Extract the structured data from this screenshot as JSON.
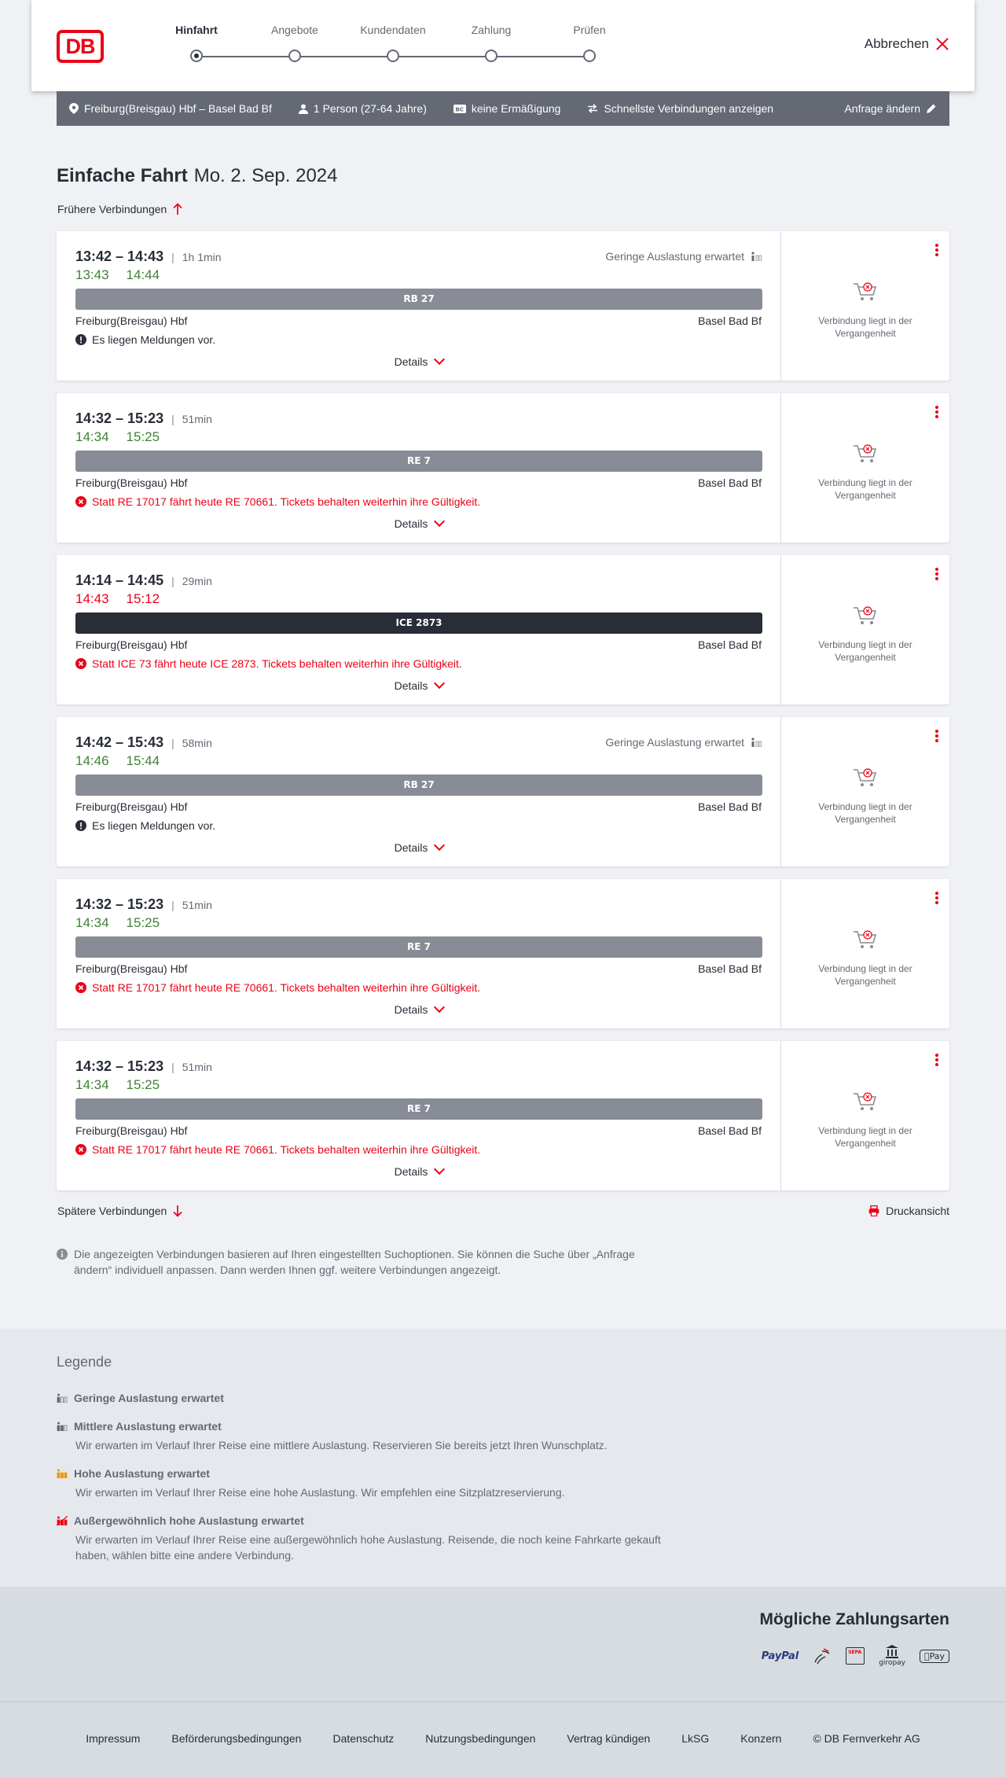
{
  "header": {
    "logo_text": "DB",
    "steps": [
      "Hinfahrt",
      "Angebote",
      "Kundendaten",
      "Zahlung",
      "Prüfen"
    ],
    "active_step": 0,
    "cancel_label": "Abbrechen"
  },
  "query": {
    "route": "Freiburg(Breisgau) Hbf – Basel Bad Bf",
    "persons": "1 Person (27-64 Jahre)",
    "discount": "keine Ermäßigung",
    "fastest": "Schnellste Verbindungen anzeigen",
    "edit_label": "Anfrage ändern"
  },
  "page": {
    "title": "Einfache Fahrt",
    "date": "Mo. 2. Sep. 2024",
    "earlier_label": "Frühere Verbindungen",
    "later_label": "Spätere Verbindungen",
    "print_label": "Druckansicht",
    "details_label": "Details",
    "past_label": "Verbindung liegt in der Vergangenheit",
    "info_text": "Die angezeigten Verbindungen basieren auf Ihren eingestellten Suchoptionen. Sie können die Suche über „Anfrage ändern“ individuell anpassen. Dann werden Ihnen ggf. weitere Verbindungen angezeigt."
  },
  "connections": [
    {
      "times": "13:42 – 14:43",
      "duration": "1h 1min",
      "rt_dep": "13:43",
      "rt_arr": "14:44",
      "rt_status": "ok",
      "load": "Geringe Auslastung erwartet",
      "train": "RB 27",
      "train_type": "regional",
      "from": "Freiburg(Breisgau) Hbf",
      "to": "Basel Bad Bf",
      "message": "Es liegen Meldungen vor.",
      "message_type": "info"
    },
    {
      "times": "14:32 – 15:23",
      "duration": "51min",
      "rt_dep": "14:34",
      "rt_arr": "15:25",
      "rt_status": "ok",
      "load": "",
      "train": "RE 7",
      "train_type": "regional",
      "from": "Freiburg(Breisgau) Hbf",
      "to": "Basel Bad Bf",
      "message": "Statt RE 17017 fährt heute RE 70661. Tickets behalten weiterhin ihre Gültigkeit.",
      "message_type": "error"
    },
    {
      "times": "14:14 – 14:45",
      "duration": "29min",
      "rt_dep": "14:43",
      "rt_arr": "15:12",
      "rt_status": "late",
      "load": "",
      "train": "ICE 2873",
      "train_type": "ice",
      "from": "Freiburg(Breisgau) Hbf",
      "to": "Basel Bad Bf",
      "message": "Statt ICE 73 fährt heute ICE 2873. Tickets behalten weiterhin ihre Gültigkeit.",
      "message_type": "error"
    },
    {
      "times": "14:42 – 15:43",
      "duration": "58min",
      "rt_dep": "14:46",
      "rt_arr": "15:44",
      "rt_status": "ok",
      "load": "Geringe Auslastung erwartet",
      "train": "RB 27",
      "train_type": "regional",
      "from": "Freiburg(Breisgau) Hbf",
      "to": "Basel Bad Bf",
      "message": "Es liegen Meldungen vor.",
      "message_type": "info"
    },
    {
      "times": "14:32 – 15:23",
      "duration": "51min",
      "rt_dep": "14:34",
      "rt_arr": "15:25",
      "rt_status": "ok",
      "load": "",
      "train": "RE 7",
      "train_type": "regional",
      "from": "Freiburg(Breisgau) Hbf",
      "to": "Basel Bad Bf",
      "message": "Statt RE 17017 fährt heute RE 70661. Tickets behalten weiterhin ihre Gültigkeit.",
      "message_type": "error"
    },
    {
      "times": "14:32 – 15:23",
      "duration": "51min",
      "rt_dep": "14:34",
      "rt_arr": "15:25",
      "rt_status": "ok",
      "load": "",
      "train": "RE 7",
      "train_type": "regional",
      "from": "Freiburg(Breisgau) Hbf",
      "to": "Basel Bad Bf",
      "message": "Statt RE 17017 fährt heute RE 70661. Tickets behalten weiterhin ihre Gültigkeit.",
      "message_type": "error"
    }
  ],
  "legend": {
    "title": "Legende",
    "items": [
      {
        "title": "Geringe Auslastung erwartet",
        "desc": "",
        "level": 1
      },
      {
        "title": "Mittlere Auslastung erwartet",
        "desc": "Wir erwarten im Verlauf Ihrer Reise eine mittlere Auslastung. Reservieren Sie bereits jetzt Ihren Wunschplatz.",
        "level": 2
      },
      {
        "title": "Hohe Auslastung erwartet",
        "desc": "Wir erwarten im Verlauf Ihrer Reise eine hohe Auslastung. Wir empfehlen eine Sitzplatzreservierung.",
        "level": 3
      },
      {
        "title": "Außergewöhnlich hohe Auslastung erwartet",
        "desc": "Wir erwarten im Verlauf Ihrer Reise eine außergewöhnlich hohe Auslastung. Reisende, die noch keine Fahrkarte gekauft haben, wählen bitte eine andere Verbindung.",
        "level": 4
      }
    ]
  },
  "payment": {
    "title": "Mögliche Zahlungsarten",
    "methods": [
      "PayPal",
      "SEPA",
      "giropay",
      "Pay"
    ]
  },
  "footer": {
    "links": [
      "Impressum",
      "Beförderungsbedingungen",
      "Datenschutz",
      "Nutzungsbedingungen",
      "Vertrag kündigen",
      "LkSG",
      "Konzern",
      "© DB Fernverkehr AG"
    ]
  },
  "colors": {
    "brand": "#ec0016",
    "ok": "#408335",
    "dark": "#282d37",
    "grey": "#646973"
  }
}
